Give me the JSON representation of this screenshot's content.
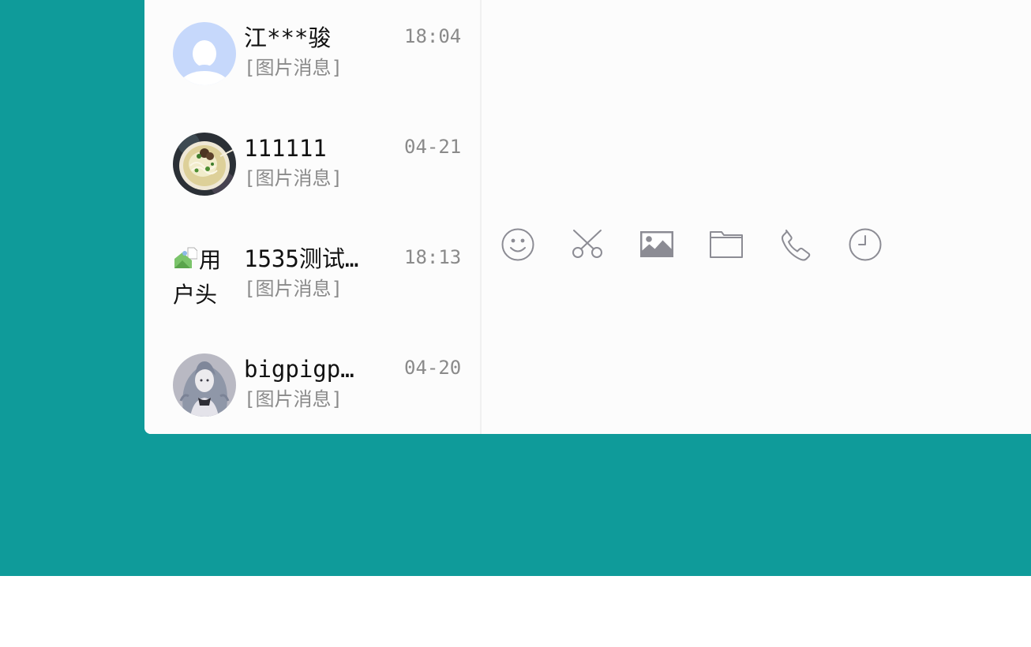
{
  "conversations": [
    {
      "name": "江***骏",
      "preview": "[图片消息]",
      "time": "18:04",
      "avatar": "default-user-avatar"
    },
    {
      "name": "111111",
      "preview": "[图片消息]",
      "time": "04-21",
      "avatar": "noodle-bowl-avatar"
    },
    {
      "name": "1535测试…",
      "preview": "[图片消息]",
      "time": "18:13",
      "avatar": "broken-image-avatar",
      "avatar_alt": "用户头"
    },
    {
      "name": "bigpigp…",
      "preview": "[图片消息]",
      "time": "04-20",
      "avatar": "anime-girl-avatar"
    }
  ],
  "toolbar": {
    "icons": [
      "emoji-icon",
      "scissors-icon",
      "image-icon",
      "folder-icon",
      "phone-icon",
      "clock-icon"
    ]
  },
  "colors": {
    "background": "#0f9b9a",
    "panel": "#fcfcfc",
    "icon": "#8c8c94",
    "muted_text": "#8a8a8a",
    "text": "#111111"
  }
}
